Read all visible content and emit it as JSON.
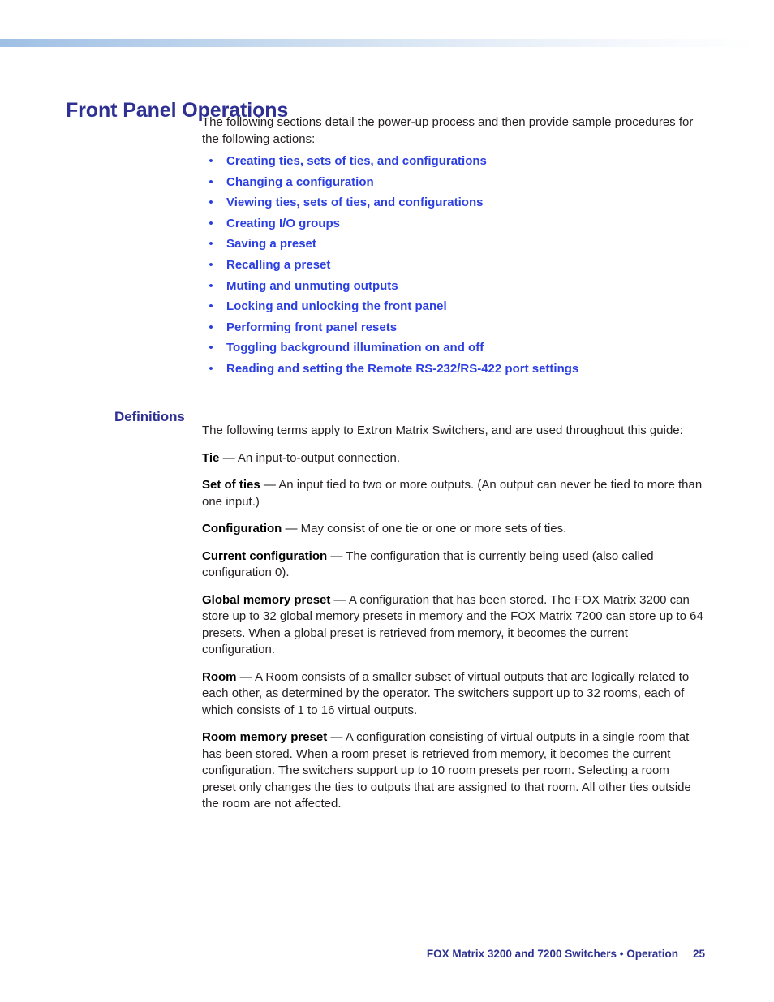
{
  "document": {
    "heading": "Front Panel Operations",
    "intro": "The following sections detail the power-up process and then provide sample procedures for the following actions:",
    "bullet_glyph": "•",
    "links": [
      {
        "label": "Creating ties, sets of ties, and configurations"
      },
      {
        "label": "Changing a configuration"
      },
      {
        "label": "Viewing ties, sets of ties, and configurations"
      },
      {
        "label": "Creating I/O groups"
      },
      {
        "label": "Saving a preset"
      },
      {
        "label": "Recalling a preset"
      },
      {
        "label": "Muting and unmuting outputs"
      },
      {
        "label": "Locking and unlocking the front panel"
      },
      {
        "label": "Performing front panel resets"
      },
      {
        "label": "Toggling background illumination on and off"
      },
      {
        "label": "Reading and setting the Remote RS-232/RS-422 port settings"
      }
    ],
    "definitions_heading": "Definitions",
    "definitions_intro": "The following terms apply to Extron Matrix Switchers, and are used throughout this guide:",
    "definitions": [
      {
        "term": "Tie",
        "body": " — An input-to-output connection."
      },
      {
        "term": "Set of ties",
        "body": " — An input tied to two or more outputs. (An output can never be tied to more than one input.)"
      },
      {
        "term": "Configuration",
        "body": " — May consist of one tie or one or more sets of ties."
      },
      {
        "term": "Current configuration",
        "body": " — The configuration that is currently being used (also called configuration 0)."
      },
      {
        "term": "Global memory preset",
        "body": " — A configuration that has been stored. The FOX Matrix 3200 can store up to 32 global memory presets in memory and the FOX Matrix 7200 can store up to 64 presets. When a global preset is retrieved from memory, it becomes the current configuration."
      },
      {
        "term": "Room",
        "body": " — A Room consists of a smaller subset of virtual outputs that are logically related to each other, as determined by the operator. The switchers support up to 32 rooms, each of which consists of 1 to 16 virtual outputs."
      },
      {
        "term": "Room memory preset",
        "body": " — A configuration consisting of virtual outputs in a single room that has been stored. When a room preset is retrieved from memory, it becomes the current configuration. The switchers support up to 10 room presets per room. Selecting a room preset only changes the ties to outputs that are assigned to that room. All other ties outside the room are not affected."
      }
    ],
    "footer": {
      "doc_name": "FOX Matrix 3200 and 7200 Switchers • Operation",
      "page_number": "25"
    },
    "colors": {
      "heading_blue": "#2e3192",
      "link_blue": "#2b3fe2",
      "body_text": "#231f20",
      "rule_gradient_start": "#9ec0e4",
      "rule_gradient_end": "#ffffff"
    }
  }
}
